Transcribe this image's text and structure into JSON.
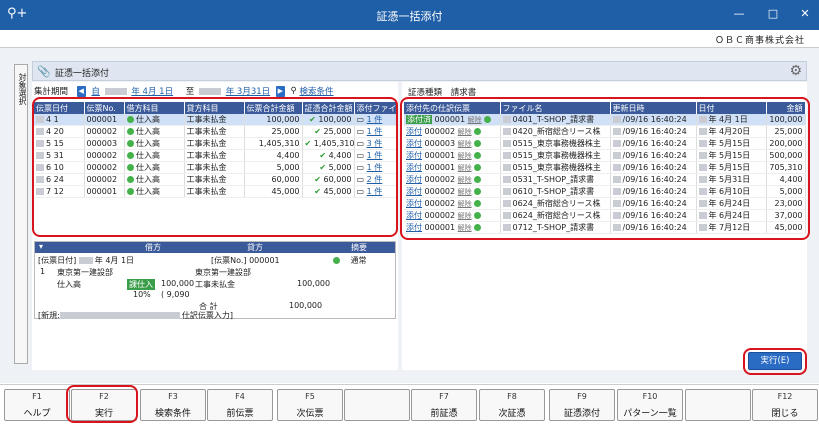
{
  "window": {
    "title": "証憑一括添付",
    "company": "ＯＢＣ商事株式会社"
  },
  "side_tab": {
    "label": "対象選択"
  },
  "panel": {
    "title": "証憑一括添付"
  },
  "period": {
    "label": "集計期間",
    "from": "年 4月 1日",
    "from_prefix": "自",
    "to": "年 3月31日",
    "to_prefix": "至",
    "search": "検索条件"
  },
  "left_grid": {
    "headers": [
      "伝票日付",
      "伝票No.",
      "借方科目",
      "貸方科目",
      "伝票合計金額",
      "証憑合計金額",
      "添付ファイル"
    ],
    "rows": [
      {
        "date": "4  1",
        "no": "000001",
        "debit": "仕入高",
        "credit": "工事未払金",
        "total": "100,000",
        "evid": "100,000",
        "file": "1 件"
      },
      {
        "date": "4 20",
        "no": "000002",
        "debit": "仕入高",
        "credit": "工事未払金",
        "total": "25,000",
        "evid": "25,000",
        "file": "1 件"
      },
      {
        "date": "5 15",
        "no": "000003",
        "debit": "仕入高",
        "credit": "工事未払金",
        "total": "1,405,310",
        "evid": "1,405,310",
        "file": "3 件"
      },
      {
        "date": "5 31",
        "no": "000002",
        "debit": "仕入高",
        "credit": "工事未払金",
        "total": "4,400",
        "evid": "4,400",
        "file": "1 件"
      },
      {
        "date": "6 10",
        "no": "000002",
        "debit": "仕入高",
        "credit": "工事未払金",
        "total": "5,000",
        "evid": "5,000",
        "file": "1 件"
      },
      {
        "date": "6 24",
        "no": "000002",
        "debit": "仕入高",
        "credit": "工事未払金",
        "total": "60,000",
        "evid": "60,000",
        "file": "2 件"
      },
      {
        "date": "7 12",
        "no": "000001",
        "debit": "仕入高",
        "credit": "工事未払金",
        "total": "45,000",
        "evid": "45,000",
        "file": "1 件"
      }
    ]
  },
  "detail": {
    "debit_header": "借方",
    "credit_header": "貸方",
    "memo_header": "摘要",
    "date_label": "[伝票日付]",
    "date_value": "年  4月  1日",
    "no_label": "[伝票No.]",
    "no_value": "000001",
    "status": "通常",
    "line_no": "1",
    "debit_dept": "東京第一建設部",
    "debit_account": "仕入高",
    "tax_badge": "課仕入",
    "debit_amount": "100,000",
    "tax_rate": "10%",
    "tax_amount": "( 9,090",
    "credit_dept": "東京第一建設部",
    "credit_account": "工事未払金",
    "credit_amount": "100,000",
    "sum_label": "合  計",
    "sum_amount": "100,000",
    "new_label": "[新規:",
    "entry_label": "仕訳伝票入力]"
  },
  "right": {
    "type_label": "証憑種類",
    "type_value": "請求書",
    "headers": [
      "添付先の仕訳伝票",
      "ファイル名",
      "更新日時",
      "日付",
      "金額"
    ],
    "rows": [
      {
        "status": "添付済",
        "no": "000001",
        "action": "解除",
        "file": "0401_T-SHOP_請求書",
        "updated": "/09/16 16:40:24",
        "date": "年  4月  1日",
        "amount": "100,000",
        "done": true
      },
      {
        "status": "添付",
        "no": "000002",
        "action": "解除",
        "file": "0420_新宿総合リース株",
        "updated": "/09/16 16:40:24",
        "date": "年  4月20日",
        "amount": "25,000",
        "done": false
      },
      {
        "status": "添付",
        "no": "000003",
        "action": "解除",
        "file": "0515_東京事務機器株主",
        "updated": "/09/16 16:40:24",
        "date": "年  5月15日",
        "amount": "200,000",
        "done": false
      },
      {
        "status": "添付",
        "no": "000001",
        "action": "解除",
        "file": "0515_東京事務機器株主",
        "updated": "/09/16 16:40:24",
        "date": "年  5月15日",
        "amount": "500,000",
        "done": false
      },
      {
        "status": "添付",
        "no": "000001",
        "action": "解除",
        "file": "0515_東京事務機器株主",
        "updated": "/09/16 16:40:24",
        "date": "年  5月15日",
        "amount": "705,310",
        "done": false
      },
      {
        "status": "添付",
        "no": "000002",
        "action": "解除",
        "file": "0531_T-SHOP_請求書",
        "updated": "/09/16 16:40:24",
        "date": "年  5月31日",
        "amount": "4,400",
        "done": false
      },
      {
        "status": "添付",
        "no": "000002",
        "action": "解除",
        "file": "0610_T-SHOP_請求書",
        "updated": "/09/16 16:40:24",
        "date": "年  6月10日",
        "amount": "5,000",
        "done": false
      },
      {
        "status": "添付",
        "no": "000002",
        "action": "解除",
        "file": "0624_新宿総合リース株",
        "updated": "/09/16 16:40:24",
        "date": "年  6月24日",
        "amount": "23,000",
        "done": false
      },
      {
        "status": "添付",
        "no": "000002",
        "action": "解除",
        "file": "0624_新宿総合リース株",
        "updated": "/09/16 16:40:24",
        "date": "年  6月24日",
        "amount": "37,000",
        "done": false
      },
      {
        "status": "添付",
        "no": "000001",
        "action": "解除",
        "file": "0712_T-SHOP_請求書",
        "updated": "/09/16 16:40:24",
        "date": "年  7月12日",
        "amount": "45,000",
        "done": false
      }
    ]
  },
  "exec_button": "実行(E)",
  "fkeys": [
    {
      "key": "F1",
      "label": "ヘルプ"
    },
    {
      "key": "F2",
      "label": "実行"
    },
    {
      "key": "F3",
      "label": "検索条件"
    },
    {
      "key": "F4",
      "label": "前伝票"
    },
    {
      "key": "F5",
      "label": "次伝票"
    },
    {
      "key": "",
      "label": ""
    },
    {
      "key": "F7",
      "label": "前証憑"
    },
    {
      "key": "F8",
      "label": "次証憑"
    },
    {
      "key": "F9",
      "label": "証憑添付"
    },
    {
      "key": "F10",
      "label": "パターン一覧"
    },
    {
      "key": "",
      "label": ""
    },
    {
      "key": "F12",
      "label": "閉じる"
    }
  ]
}
